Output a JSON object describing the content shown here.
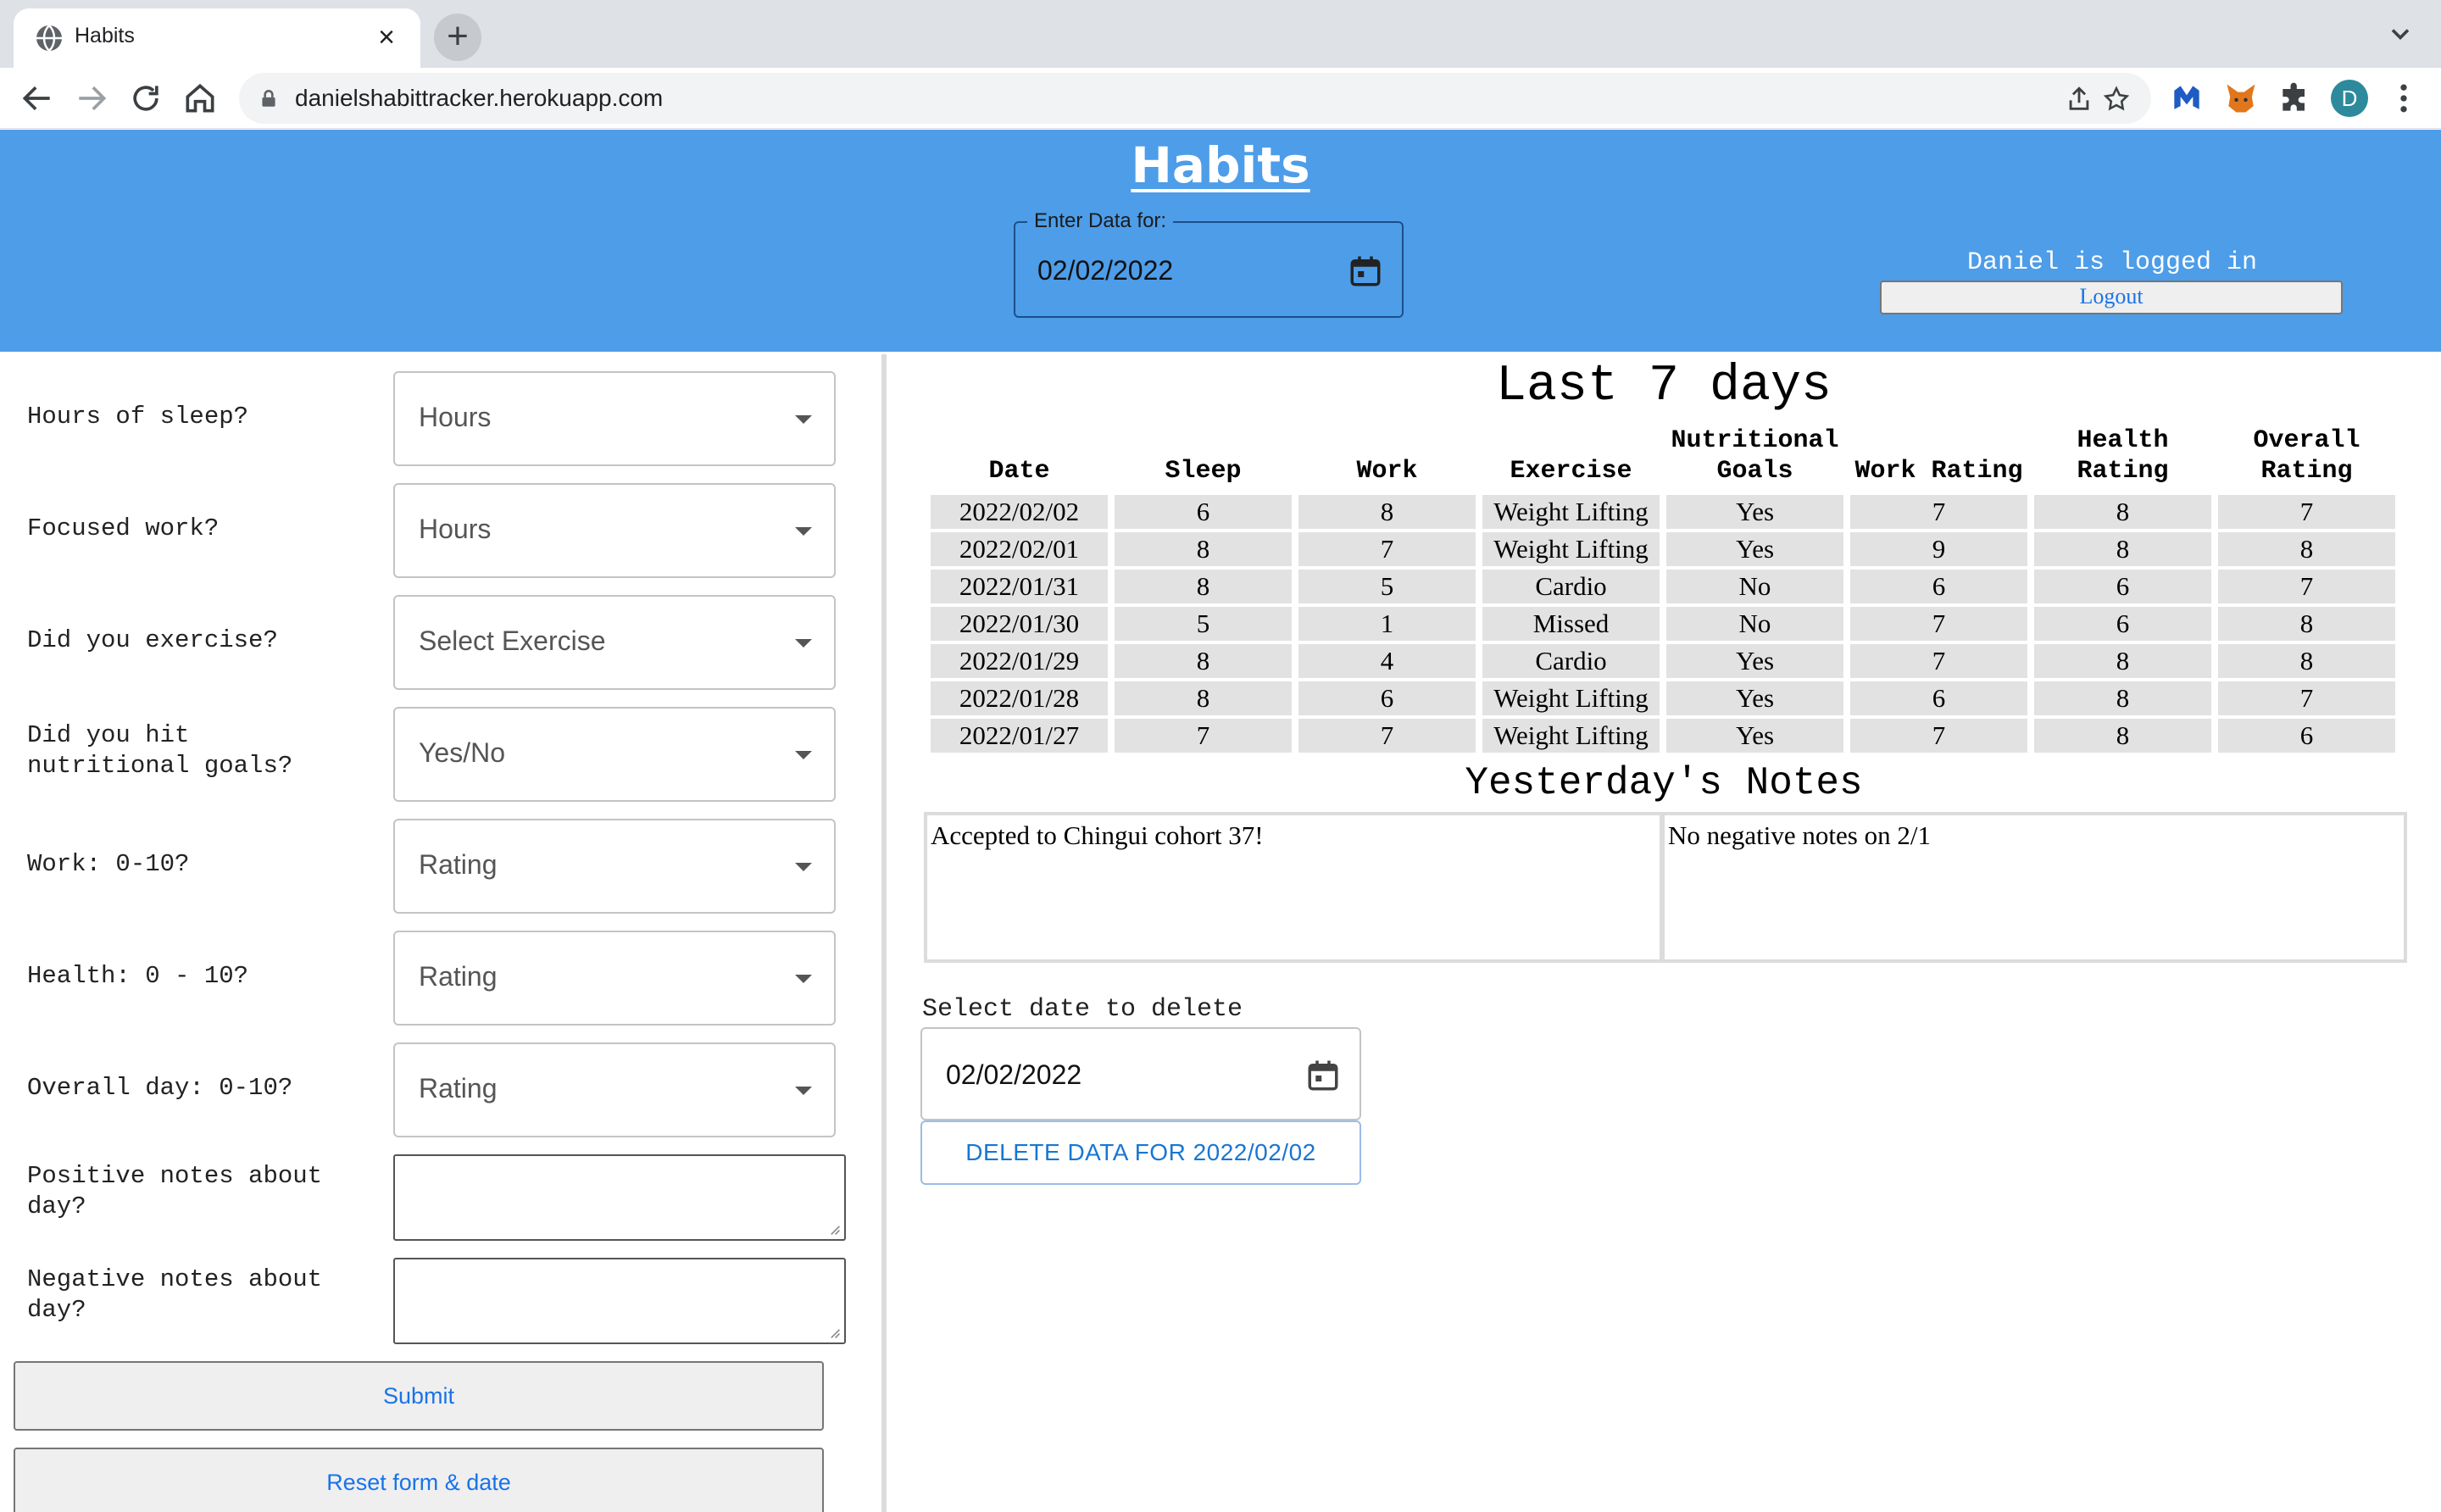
{
  "browser": {
    "tab_title": "Habits",
    "url": "danielshabittracker.herokuapp.com",
    "profile_initial": "D",
    "new_tab_symbol": "+",
    "close_symbol": "×"
  },
  "header": {
    "title": "Habits",
    "date_legend": "Enter Data for:",
    "date_value": "02/02/2022",
    "logged_in_text": "Daniel is logged in",
    "logout_label": "Logout"
  },
  "form": {
    "fields": [
      {
        "label": "Hours of sleep?",
        "value": "Hours"
      },
      {
        "label": "Focused work?",
        "value": "Hours"
      },
      {
        "label": "Did you exercise?",
        "value": "Select Exercise"
      },
      {
        "label": "Did you hit nutritional goals?",
        "value": "Yes/No"
      },
      {
        "label": "Work: 0-10?",
        "value": "Rating"
      },
      {
        "label": "Health: 0 - 10?",
        "value": "Rating"
      },
      {
        "label": "Overall day: 0-10?",
        "value": "Rating"
      }
    ],
    "positive_notes_label": "Positive notes about day?",
    "negative_notes_label": "Negative notes about day?",
    "submit_label": "Submit",
    "reset_label": "Reset form & date"
  },
  "history": {
    "title": "Last 7 days",
    "columns": [
      "Date",
      "Sleep",
      "Work",
      "Exercise",
      "Nutritional Goals",
      "Work Rating",
      "Health Rating",
      "Overall Rating"
    ],
    "rows": [
      [
        "2022/02/02",
        "6",
        "8",
        "Weight Lifting",
        "Yes",
        "7",
        "8",
        "7"
      ],
      [
        "2022/02/01",
        "8",
        "7",
        "Weight Lifting",
        "Yes",
        "9",
        "8",
        "8"
      ],
      [
        "2022/01/31",
        "8",
        "5",
        "Cardio",
        "No",
        "6",
        "6",
        "7"
      ],
      [
        "2022/01/30",
        "5",
        "1",
        "Missed",
        "No",
        "7",
        "6",
        "8"
      ],
      [
        "2022/01/29",
        "8",
        "4",
        "Cardio",
        "Yes",
        "7",
        "8",
        "8"
      ],
      [
        "2022/01/28",
        "8",
        "6",
        "Weight Lifting",
        "Yes",
        "6",
        "8",
        "7"
      ],
      [
        "2022/01/27",
        "7",
        "7",
        "Weight Lifting",
        "Yes",
        "7",
        "8",
        "6"
      ]
    ]
  },
  "notes": {
    "title": "Yesterday's Notes",
    "positive": "Accepted to Chingui cohort 37!",
    "negative": "No negative notes on 2/1"
  },
  "delete": {
    "label": "Select date to delete",
    "date_value": "02/02/2022",
    "button_label": "DELETE DATA FOR 2022/02/02"
  },
  "colors": {
    "header_bg": "#4d9de9",
    "link_blue": "#1a73e8",
    "cell_bg": "#e2e2e2"
  }
}
